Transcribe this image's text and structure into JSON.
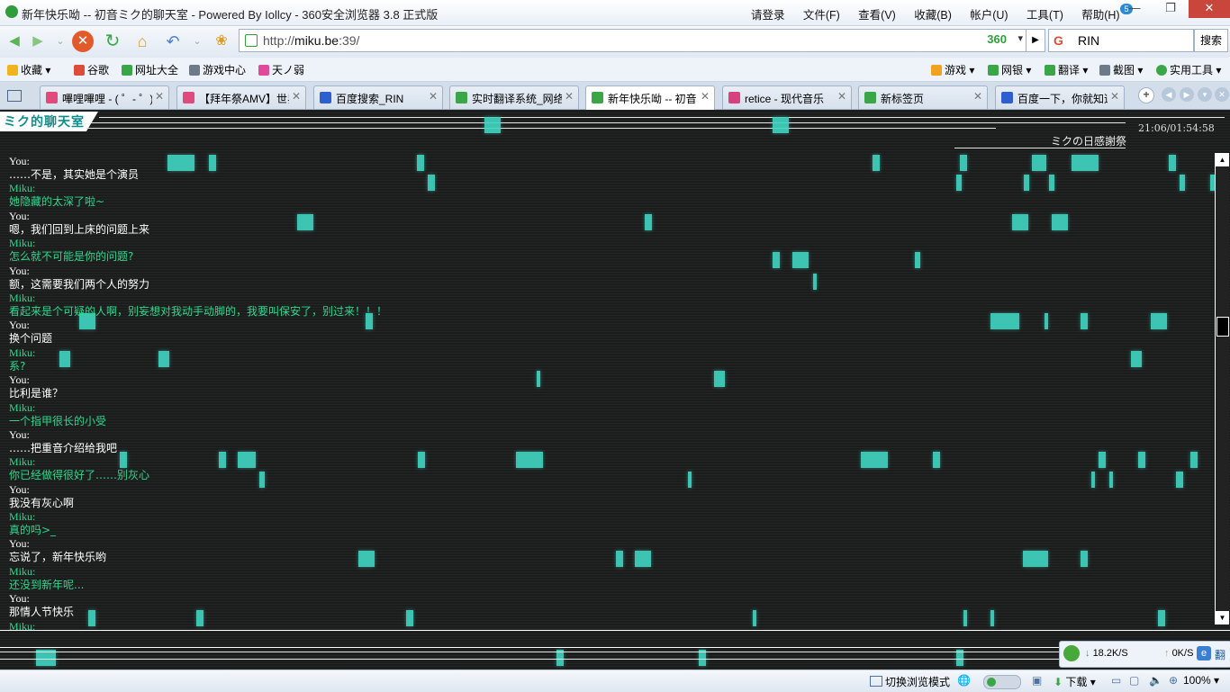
{
  "window": {
    "title": "新年快乐呦 -- 初音ミク的聊天室 - Powered By Iollcy - 360安全浏览器 3.8 正式版",
    "login": "请登录",
    "menu": [
      "文件(F)",
      "查看(V)",
      "收藏(B)",
      "帐户(U)",
      "工具(T)",
      "帮助(H)"
    ],
    "badge": "5"
  },
  "nav": {
    "url_prefix": "http://",
    "url_host": "miku.be",
    "url_port": ":39/",
    "security_badge": "360",
    "search_engine": "G",
    "search_value": "RIN",
    "search_button": "搜索"
  },
  "bookmarks": {
    "left": [
      "收藏",
      "谷歌",
      "网址大全",
      "游戏中心",
      "天ノ弱"
    ],
    "right": [
      "游戏",
      "网银",
      "翻译",
      "截图",
      "实用工具"
    ]
  },
  "tabs": [
    {
      "label": "嗶哩嗶哩 - ( ゜- ゜)つ",
      "color": "#e04a7c"
    },
    {
      "label": "【拜年祭AMV】世界第",
      "color": "#e04a7c"
    },
    {
      "label": "百度搜索_RIN",
      "color": "#2e5fd1"
    },
    {
      "label": "实时翻译系统_网络翻译",
      "color": "#3aa647"
    },
    {
      "label": "新年快乐呦 -- 初音ミク",
      "color": "#3aa647"
    },
    {
      "label": "retice - 现代音乐",
      "color": "#d84080"
    },
    {
      "label": "新标签页",
      "color": "#3aa647"
    },
    {
      "label": "百度一下，你就知道",
      "color": "#2e5fd1"
    }
  ],
  "active_tab_index": 4,
  "page": {
    "logo": "ミク的聊天室",
    "clock": "21:06/01:54:58",
    "emotion_label": "ミクの日感謝祭",
    "you_label": "You:",
    "miku_label": "Miku:",
    "messages": [
      {
        "who": "You",
        "text": "……不是，其实她是个演员"
      },
      {
        "who": "Miku",
        "text": "她隐藏的太深了啦~"
      },
      {
        "who": "You",
        "text": "嗯，我们回到上床的问题上来"
      },
      {
        "who": "Miku",
        "text": "怎么就不可能是你的问题?"
      },
      {
        "who": "You",
        "text": "额，这需要我们两个人的努力"
      },
      {
        "who": "Miku",
        "text": "看起来是个可疑的人啊，别妄想对我动手动脚的，我要叫保安了，别过来！！！"
      },
      {
        "who": "You",
        "text": "换个问题"
      },
      {
        "who": "Miku",
        "text": "系?"
      },
      {
        "who": "You",
        "text": "比利是谁？"
      },
      {
        "who": "Miku",
        "text": "一个指甲很长的小受"
      },
      {
        "who": "You",
        "text": "……把重音介绍给我吧"
      },
      {
        "who": "Miku",
        "text": "你已经做得很好了……别灰心"
      },
      {
        "who": "You",
        "text": "我没有灰心啊"
      },
      {
        "who": "Miku",
        "text": "真的吗>_"
      },
      {
        "who": "You",
        "text": "忘说了，新年快乐哟"
      },
      {
        "who": "Miku",
        "text": "还没到新年呢..."
      },
      {
        "who": "You",
        "text": "那情人节快乐"
      },
      {
        "who": "Miku",
        "text": ""
      }
    ]
  },
  "network": {
    "download": "18.2K/S",
    "upload": "0K/S",
    "translate": "翻"
  },
  "status": {
    "mode_switch": "切换浏览模式",
    "download": "下载",
    "zoom": "100%"
  },
  "colors": {
    "accent_cyan": "#40d6c2",
    "miku_text": "#2bd98f",
    "page_bg": "#1b1d1c"
  }
}
